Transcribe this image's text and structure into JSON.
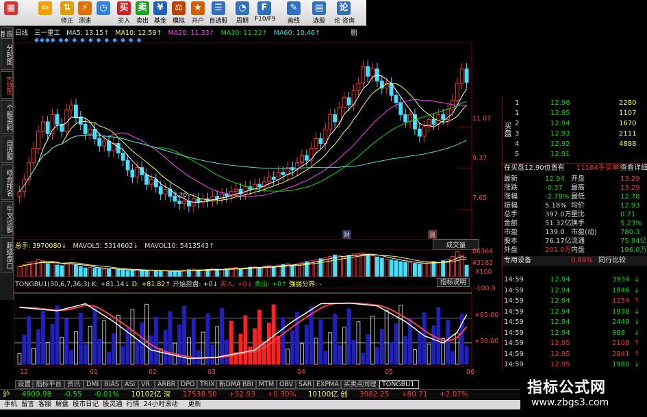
{
  "toolbar": [
    {
      "label": "",
      "icon": "app-logo-icon",
      "color": "#e03030"
    },
    {
      "label": "",
      "icon": "back-arrow-icon",
      "color": "#f0a000"
    },
    {
      "label": "修正",
      "icon": "up-down-icon",
      "color": "#e0a000"
    },
    {
      "label": "测速",
      "icon": "speed-test-icon",
      "color": "#e07000"
    },
    {
      "label": "",
      "icon": "clock-icon",
      "color": "#3080e0"
    },
    {
      "label": "买入",
      "icon": "buy-icon",
      "color": "#d02020"
    },
    {
      "label": "卖出",
      "icon": "sell-icon",
      "color": "#20a020"
    },
    {
      "label": "基金",
      "icon": "fund-icon",
      "color": "#2060c0"
    },
    {
      "label": "模拟",
      "icon": "simulate-icon",
      "color": "#c04000"
    },
    {
      "label": "开户",
      "icon": "open-account-icon",
      "color": "#d06000"
    },
    {
      "label": "自选股",
      "icon": "watchlist-icon",
      "color": "#3070c0"
    },
    {
      "label": "周期",
      "icon": "period-icon",
      "color": "#3070c0"
    },
    {
      "label": "F10/F9",
      "icon": "f10-icon",
      "color": "#3070c0"
    },
    {
      "label": "画线",
      "icon": "draw-line-icon",
      "color": "#3070c0"
    },
    {
      "label": "选股",
      "icon": "stock-filter-icon",
      "color": "#3070c0"
    },
    {
      "label": "论 咨询",
      "icon": "forum-icon",
      "color": "#3070c0"
    }
  ],
  "sidetabs": [
    {
      "label": "应用"
    },
    {
      "label": "分时图"
    },
    {
      "label": "K线图",
      "active": true
    },
    {
      "label": "个股资料"
    },
    {
      "label": "自选股"
    },
    {
      "label": "综合排名"
    },
    {
      "label": "牛叉诊股"
    },
    {
      "label": "超级盘口"
    }
  ],
  "ma_header": {
    "period": "日线",
    "name": "三一重工",
    "ma5": "MA5: 13.15↑",
    "ma10": "MA10: 12.59↑",
    "ma20": "MA20: 11.33↑",
    "ma30": "MA30: 11.22↑",
    "ma60": "MA60: 10.46↑",
    "more": "删"
  },
  "price_axis": [
    "11.07",
    "9.37",
    "7.65"
  ],
  "low_label": "7.70",
  "markers": [
    "财",
    "涨"
  ],
  "volume_header": {
    "total": "总手: 3970080↓",
    "mavol5": "MAVOL5: 5314602↓",
    "mavol10": "MAVOL10: 5413543↑",
    "tab": "成交量"
  },
  "volume_axis": [
    "86364",
    "43182",
    "X100"
  ],
  "indicator_header": {
    "name": "TONGBU1(30,6,7,36,3)",
    "k": "K: +81.14↓",
    "d": "D: +81.82↑",
    "kaishi": "开始控盘: +0↓",
    "mairu": "买入: +0↓",
    "maichu": "卖出: +0↑",
    "qiangruo": "强弱分界: -",
    "btn": "指标说明"
  },
  "indicator_axis": [
    "-100.0",
    "+65.00",
    "+30.00"
  ],
  "date_axis": [
    "12",
    "01",
    "02",
    "03",
    "04",
    "05",
    "06"
  ],
  "bottom_tabs": [
    "设置",
    "指标平台",
    "资讯",
    "DMI",
    "BIAS",
    "ASI",
    "VR",
    "ARBR",
    "DPO",
    "TRIX",
    "新DMA",
    "BBI",
    "MTM",
    "OBV",
    "SAR",
    "EXPMA",
    "买卖点同理",
    "TONGBU1"
  ],
  "quote_bar": {
    "mkt1": "沪",
    "v1": "4909.98",
    "c1": "-0.55",
    "p1": "-0.01%",
    "amt1": "10102亿",
    "mkt2": "深",
    "v2": "17538.50",
    "c2": "+52.93",
    "p2": "+0.30%",
    "amt2": "10100亿",
    "mkt3": "创",
    "v3": "3982.25",
    "c3": "+80.71",
    "p3": "+2.07%"
  },
  "status_bar": [
    "手机",
    "留言",
    "客服",
    "解盘",
    "股市日记",
    "股灵通",
    "行情",
    "24小时滚动",
    "  ",
    "更新"
  ],
  "buy_levels": [
    {
      "n": "1",
      "price": "12.96",
      "vol": "2280"
    },
    {
      "n": "1",
      "price": "12.95",
      "vol": "1107"
    },
    {
      "n": "2",
      "price": "12.94",
      "vol": "1670"
    },
    {
      "n": "3",
      "price": "12.93",
      "vol": "2111"
    },
    {
      "n": "4",
      "price": "12.92",
      "vol": "4888"
    },
    {
      "n": "5",
      "price": "12.91",
      "vol": ""
    }
  ],
  "buy_label": "买盘",
  "order_note": {
    "a": "在买盘12.90位置有",
    "b": "11164手",
    "c": "买单!",
    "d": "查看详细"
  },
  "stats": [
    {
      "l1": "最新",
      "v1": "12.94",
      "l2": "开盘",
      "v2": "13.29"
    },
    {
      "l1": "涨跌",
      "v1": "-0.37",
      "l2": "最高",
      "v2": "13.29"
    },
    {
      "l1": "涨幅",
      "v1": "-2.78%",
      "l2": "最低",
      "v2": "12.78"
    },
    {
      "l1": "振幅",
      "v1": "5.18%",
      "l2": "均价",
      "v2": "12.93"
    },
    {
      "l1": "总手",
      "v1": "397.0万",
      "l2": "量比",
      "v2": "0.71"
    },
    {
      "l1": "金额",
      "v1": "51.32亿",
      "l2": "换手",
      "v2": "5.23%"
    },
    {
      "l1": "市盈",
      "v1": "139.0",
      "l2": "市盈(动)",
      "v2": "780.3"
    },
    {
      "l1": "股本",
      "v1": "76.17亿",
      "l2": "流通",
      "v2": "75.94亿"
    },
    {
      "l1": "外盘",
      "v1": "201.0万",
      "l2": "内盘",
      "v2": "196.0万"
    }
  ],
  "device": {
    "label": "专用设备",
    "pct": "0.89%",
    "btn": "同行比较"
  },
  "ticks": [
    {
      "t": "14:59",
      "p": "12.94",
      "v": "3934",
      "d": "down"
    },
    {
      "t": "14:59",
      "p": "12.94",
      "v": "1846",
      "d": "down"
    },
    {
      "t": "14:59",
      "p": "12.94",
      "v": "1254",
      "d": "up"
    },
    {
      "t": "14:59",
      "p": "12.94",
      "v": "1938",
      "d": "down"
    },
    {
      "t": "14:59",
      "p": "12.94",
      "v": "2449",
      "d": "down"
    },
    {
      "t": "14:59",
      "p": "12.94",
      "v": "908",
      "d": "down"
    },
    {
      "t": "14:59",
      "p": "12.95",
      "v": "2108",
      "d": "up"
    },
    {
      "t": "14:59",
      "p": "12.95",
      "v": "2841",
      "d": "up"
    },
    {
      "t": "14:59",
      "p": "12.95",
      "v": "1980",
      "d": "down"
    }
  ],
  "watermark": {
    "title": "指标公式网",
    "url": "www.zbgs3.com"
  },
  "chart_data": {
    "type": "candlestick",
    "price_ticks": [
      11.07,
      9.37,
      7.65
    ],
    "low_marked": 7.7,
    "close": [
      8.4,
      8.9,
      9.6,
      10.2,
      10.9,
      11.3,
      10.8,
      11.6,
      11.2,
      10.9,
      11.8,
      12.0,
      11.5,
      11.2,
      10.8,
      11.0,
      10.6,
      10.3,
      10.5,
      10.1,
      10.4,
      10.0,
      9.7,
      9.3,
      9.0,
      9.4,
      9.1,
      8.7,
      8.9,
      8.6,
      8.3,
      8.5,
      8.2,
      8.0,
      7.9,
      8.0,
      7.8,
      8.1,
      7.95,
      8.1,
      8.0,
      8.2,
      8.1,
      8.3,
      8.2,
      8.4,
      8.5,
      8.3,
      8.6,
      8.5,
      8.7,
      8.6,
      8.8,
      9.0,
      8.9,
      9.2,
      9.1,
      9.4,
      9.3,
      9.6,
      9.9,
      9.7,
      10.2,
      10.6,
      10.4,
      11.0,
      11.6,
      11.3,
      11.9,
      12.3,
      12.0,
      12.6,
      12.9,
      13.6,
      13.2,
      13.5,
      13.0,
      12.7,
      12.9,
      12.4,
      12.1,
      11.6,
      11.3,
      11.6,
      11.0,
      10.7,
      11.1,
      11.4,
      11.2,
      11.6,
      11.4,
      11.8,
      12.2,
      12.9,
      13.5,
      12.94
    ],
    "volume_k": [
      35,
      42,
      48,
      52,
      60,
      55,
      45,
      50,
      40,
      38,
      45,
      48,
      40,
      35,
      30,
      32,
      30,
      28,
      26,
      25,
      27,
      24,
      22,
      20,
      22,
      24,
      21,
      20,
      22,
      19,
      18,
      20,
      19,
      17,
      20,
      22,
      24,
      26,
      23,
      22,
      25,
      28,
      26,
      24,
      27,
      30,
      32,
      28,
      30,
      33,
      35,
      32,
      36,
      38,
      35,
      40,
      42,
      45,
      40,
      44,
      48,
      52,
      55,
      58,
      62,
      66,
      70,
      75,
      72,
      68,
      74,
      78,
      80,
      82,
      76,
      72,
      68,
      64,
      60,
      58,
      55,
      52,
      50,
      48,
      46,
      44,
      46,
      50,
      52,
      48,
      55,
      60,
      70,
      86,
      75,
      39.7
    ],
    "indicator_range": [
      0,
      100
    ],
    "indicator_ticks": [
      100,
      65,
      30
    ]
  }
}
